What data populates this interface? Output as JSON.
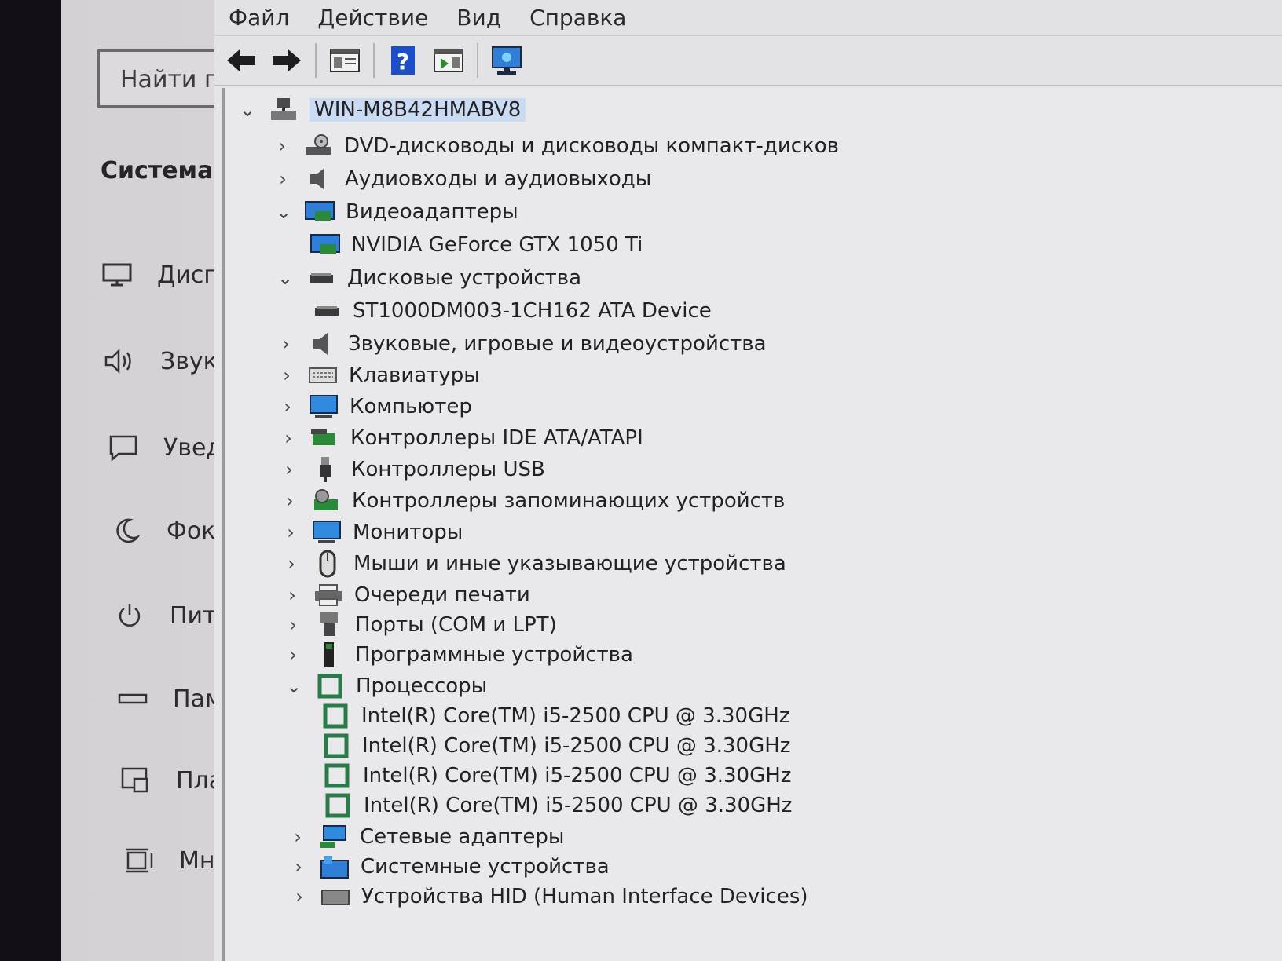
{
  "settings": {
    "search_placeholder": "Найти п",
    "heading": "Система",
    "nav": [
      {
        "icon": "monitor-icon",
        "label": "Дисп"
      },
      {
        "icon": "speaker-icon",
        "label": "Звук"
      },
      {
        "icon": "notification-icon",
        "label": "Увед"
      },
      {
        "icon": "moon-icon",
        "label": "Фоку"
      },
      {
        "icon": "power-icon",
        "label": "Пита"
      },
      {
        "icon": "storage-icon",
        "label": "Памя"
      },
      {
        "icon": "tablet-icon",
        "label": "План"
      },
      {
        "icon": "multitask-icon",
        "label": "Мно"
      }
    ]
  },
  "device_manager": {
    "menu": [
      "Файл",
      "Действие",
      "Вид",
      "Справка"
    ],
    "toolbar": [
      "back-icon",
      "forward-icon",
      "properties-icon",
      "help-icon",
      "run-icon",
      "monitor-scan-icon"
    ],
    "root": "WIN-M8B42HMABV8",
    "tree": [
      {
        "label": "DVD-дисководы и дисководы компакт-дисков",
        "icon": "dvd-icon",
        "expanded": false,
        "level": 1
      },
      {
        "label": "Аудиовходы и аудиовыходы",
        "icon": "audio-icon",
        "expanded": false,
        "level": 1
      },
      {
        "label": "Видеоадаптеры",
        "icon": "display-adapter-icon",
        "expanded": true,
        "level": 1
      },
      {
        "label": "NVIDIA GeForce GTX 1050 Ti",
        "icon": "display-adapter-icon",
        "level": 2
      },
      {
        "label": "Дисковые устройства",
        "icon": "disk-icon",
        "expanded": true,
        "level": 1
      },
      {
        "label": "ST1000DM003-1CH162 ATA Device",
        "icon": "disk-icon",
        "level": 2
      },
      {
        "label": "Звуковые, игровые и видеоустройства",
        "icon": "audio-icon",
        "expanded": false,
        "level": 1
      },
      {
        "label": "Клавиатуры",
        "icon": "keyboard-icon",
        "expanded": false,
        "level": 1
      },
      {
        "label": "Компьютер",
        "icon": "computer-icon",
        "expanded": false,
        "level": 1
      },
      {
        "label": "Контроллеры IDE ATA/ATAPI",
        "icon": "ide-controller-icon",
        "expanded": false,
        "level": 1
      },
      {
        "label": "Контроллеры USB",
        "icon": "usb-icon",
        "expanded": false,
        "level": 1
      },
      {
        "label": "Контроллеры запоминающих устройств",
        "icon": "storage-controller-icon",
        "expanded": false,
        "level": 1
      },
      {
        "label": "Мониторы",
        "icon": "computer-icon",
        "expanded": false,
        "level": 1
      },
      {
        "label": "Мыши и иные указывающие устройства",
        "icon": "mouse-icon",
        "expanded": false,
        "level": 1
      },
      {
        "label": "Очереди печати",
        "icon": "printer-icon",
        "expanded": false,
        "level": 1
      },
      {
        "label": "Порты (COM и LPT)",
        "icon": "port-icon",
        "expanded": false,
        "level": 1
      },
      {
        "label": "Программные устройства",
        "icon": "software-device-icon",
        "expanded": false,
        "level": 1
      },
      {
        "label": "Процессоры",
        "icon": "processor-icon",
        "expanded": true,
        "level": 1
      },
      {
        "label": "Intel(R) Core(TM) i5-2500 CPU @ 3.30GHz",
        "icon": "processor-icon",
        "level": 2
      },
      {
        "label": "Intel(R) Core(TM) i5-2500 CPU @ 3.30GHz",
        "icon": "processor-icon",
        "level": 2
      },
      {
        "label": "Intel(R) Core(TM) i5-2500 CPU @ 3.30GHz",
        "icon": "processor-icon",
        "level": 2
      },
      {
        "label": "Intel(R) Core(TM) i5-2500 CPU @ 3.30GHz",
        "icon": "processor-icon",
        "level": 2
      },
      {
        "label": "Сетевые адаптеры",
        "icon": "network-icon",
        "expanded": false,
        "level": 1
      },
      {
        "label": "Системные устройства",
        "icon": "system-device-icon",
        "expanded": false,
        "level": 1
      },
      {
        "label": "Устройства HID (Human Interface Devices)",
        "icon": "hid-icon",
        "expanded": false,
        "level": 1
      }
    ]
  }
}
